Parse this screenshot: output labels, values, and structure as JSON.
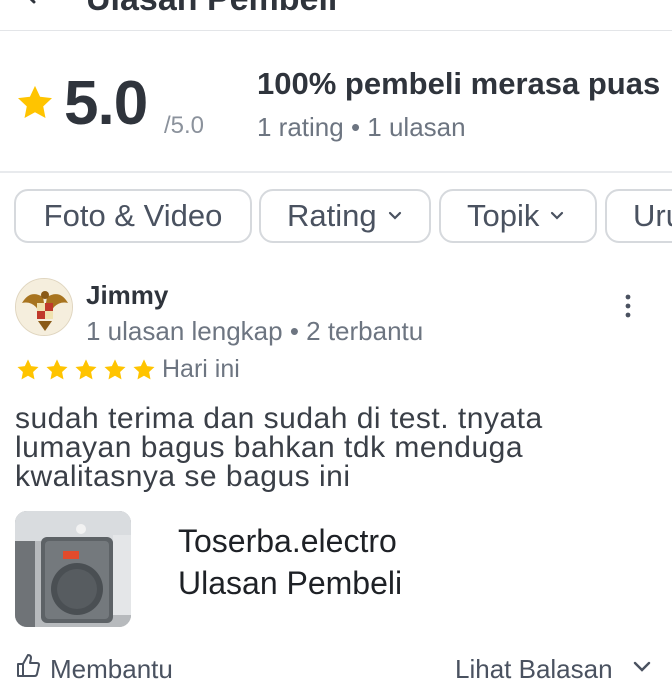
{
  "header": {
    "title": "Ulasan Pembeli"
  },
  "summary": {
    "score": "5.0",
    "score_max": "/5.0",
    "satisfied_text": "100% pembeli merasa puas",
    "counts_text": "1 rating • 1 ulasan",
    "star_color": "#FFC400"
  },
  "filters": [
    {
      "label": "Foto & Video"
    },
    {
      "label": "Rating"
    },
    {
      "label": "Topik"
    },
    {
      "label": "Urutkan"
    }
  ],
  "review": {
    "reviewer_name": "Jimmy",
    "reviewer_meta": "1 ulasan lengkap • 2 terbantu",
    "rating": 5,
    "date": "Hari ini",
    "text_lines": [
      "sudah terima dan sudah di test. tnyata",
      "lumayan bagus bahkan tdk menduga",
      "kwalitasnya se bagus ini"
    ],
    "watermark_line1": "Toserba.electro",
    "watermark_line2": "Ulasan Pembeli",
    "helpful_label": "Membantu",
    "see_reply_label": "Lihat Balasan"
  }
}
